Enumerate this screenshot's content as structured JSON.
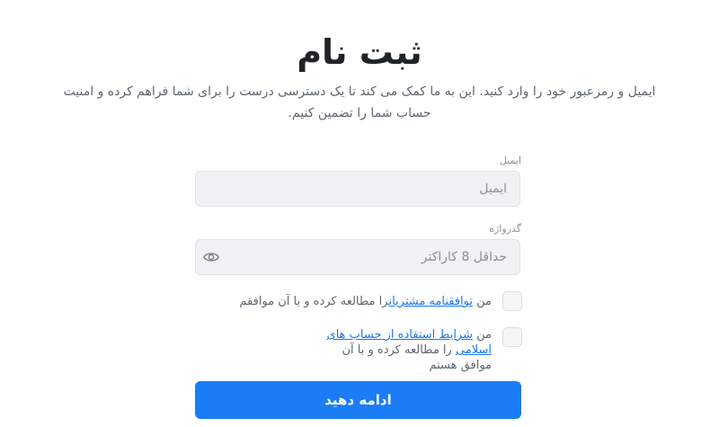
{
  "header": {
    "title": "ثبت نام",
    "description": "ایمیل و رمزعبور خود را وارد کنید. این به ما کمک می کند تا یک دسترسی درست را برای شما فراهم کرده و امنیت حساب شما را تضمین کنیم."
  },
  "form": {
    "email": {
      "label": "ایمیل",
      "placeholder": "ایمیل",
      "value": ""
    },
    "password": {
      "label": "گذرواژه",
      "placeholder": "حداقل 8 کاراکتر",
      "value": "",
      "toggle_icon": "eye-icon"
    },
    "agreements": [
      {
        "prefix": "من ",
        "link": "توافقنامه مشتریان",
        "suffix": "را مطالعه کرده و با آن موافقم",
        "checked": false
      },
      {
        "prefix": "من ",
        "link": "شرایط استفاده از حساب های اسلامی",
        "suffix": " را مطالعه کرده و با آن موافق هستم",
        "checked": false
      }
    ],
    "submit_label": "ادامه دهید"
  },
  "colors": {
    "accent": "#1a7df5",
    "link": "#1877f2",
    "input_bg": "#f1f2f3"
  }
}
